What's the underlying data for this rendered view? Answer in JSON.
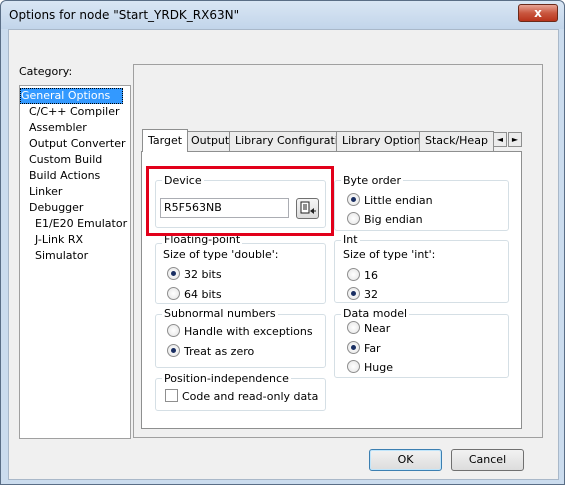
{
  "window": {
    "title": "Options for node \"Start_YRDK_RX63N\"",
    "close_label": "x"
  },
  "category": {
    "label": "Category:",
    "items": [
      {
        "label": "General Options",
        "selected": true
      },
      {
        "label": "C/C++ Compiler"
      },
      {
        "label": "Assembler"
      },
      {
        "label": "Output Converter"
      },
      {
        "label": "Custom Build"
      },
      {
        "label": "Build Actions"
      },
      {
        "label": "Linker"
      },
      {
        "label": "Debugger"
      },
      {
        "label": "E1/E20 Emulator"
      },
      {
        "label": "J-Link RX"
      },
      {
        "label": "Simulator"
      }
    ]
  },
  "tabs": [
    "Target",
    "Output",
    "Library Configuration",
    "Library Options",
    "Stack/Heap"
  ],
  "tab_scroll": {
    "left": "◄",
    "right": "►"
  },
  "device": {
    "title": "Device",
    "value": "R5F563NB",
    "button_icon": "device-select-icon"
  },
  "floating_point": {
    "title": "Floating-point",
    "subtitle": "Size of type 'double':",
    "options": [
      "32 bits",
      "64 bits"
    ],
    "selected": "32 bits"
  },
  "subnormal": {
    "title": "Subnormal numbers",
    "options": [
      "Handle with exceptions",
      "Treat as zero"
    ],
    "selected": "Treat as zero"
  },
  "position_independence": {
    "title": "Position-independence",
    "checkbox": "Code and read-only data",
    "checked": false
  },
  "byte_order": {
    "title": "Byte order",
    "options": [
      "Little endian",
      "Big endian"
    ],
    "selected": "Little endian"
  },
  "int_group": {
    "title": "Int",
    "subtitle": "Size of type 'int':",
    "options": [
      "16",
      "32"
    ],
    "selected": "32"
  },
  "data_model": {
    "title": "Data model",
    "options": [
      "Near",
      "Far",
      "Huge"
    ],
    "selected": "Far"
  },
  "buttons": {
    "ok": "OK",
    "cancel": "Cancel"
  },
  "colors": {
    "highlight": "#e2001a",
    "selection": "#3399ff"
  }
}
